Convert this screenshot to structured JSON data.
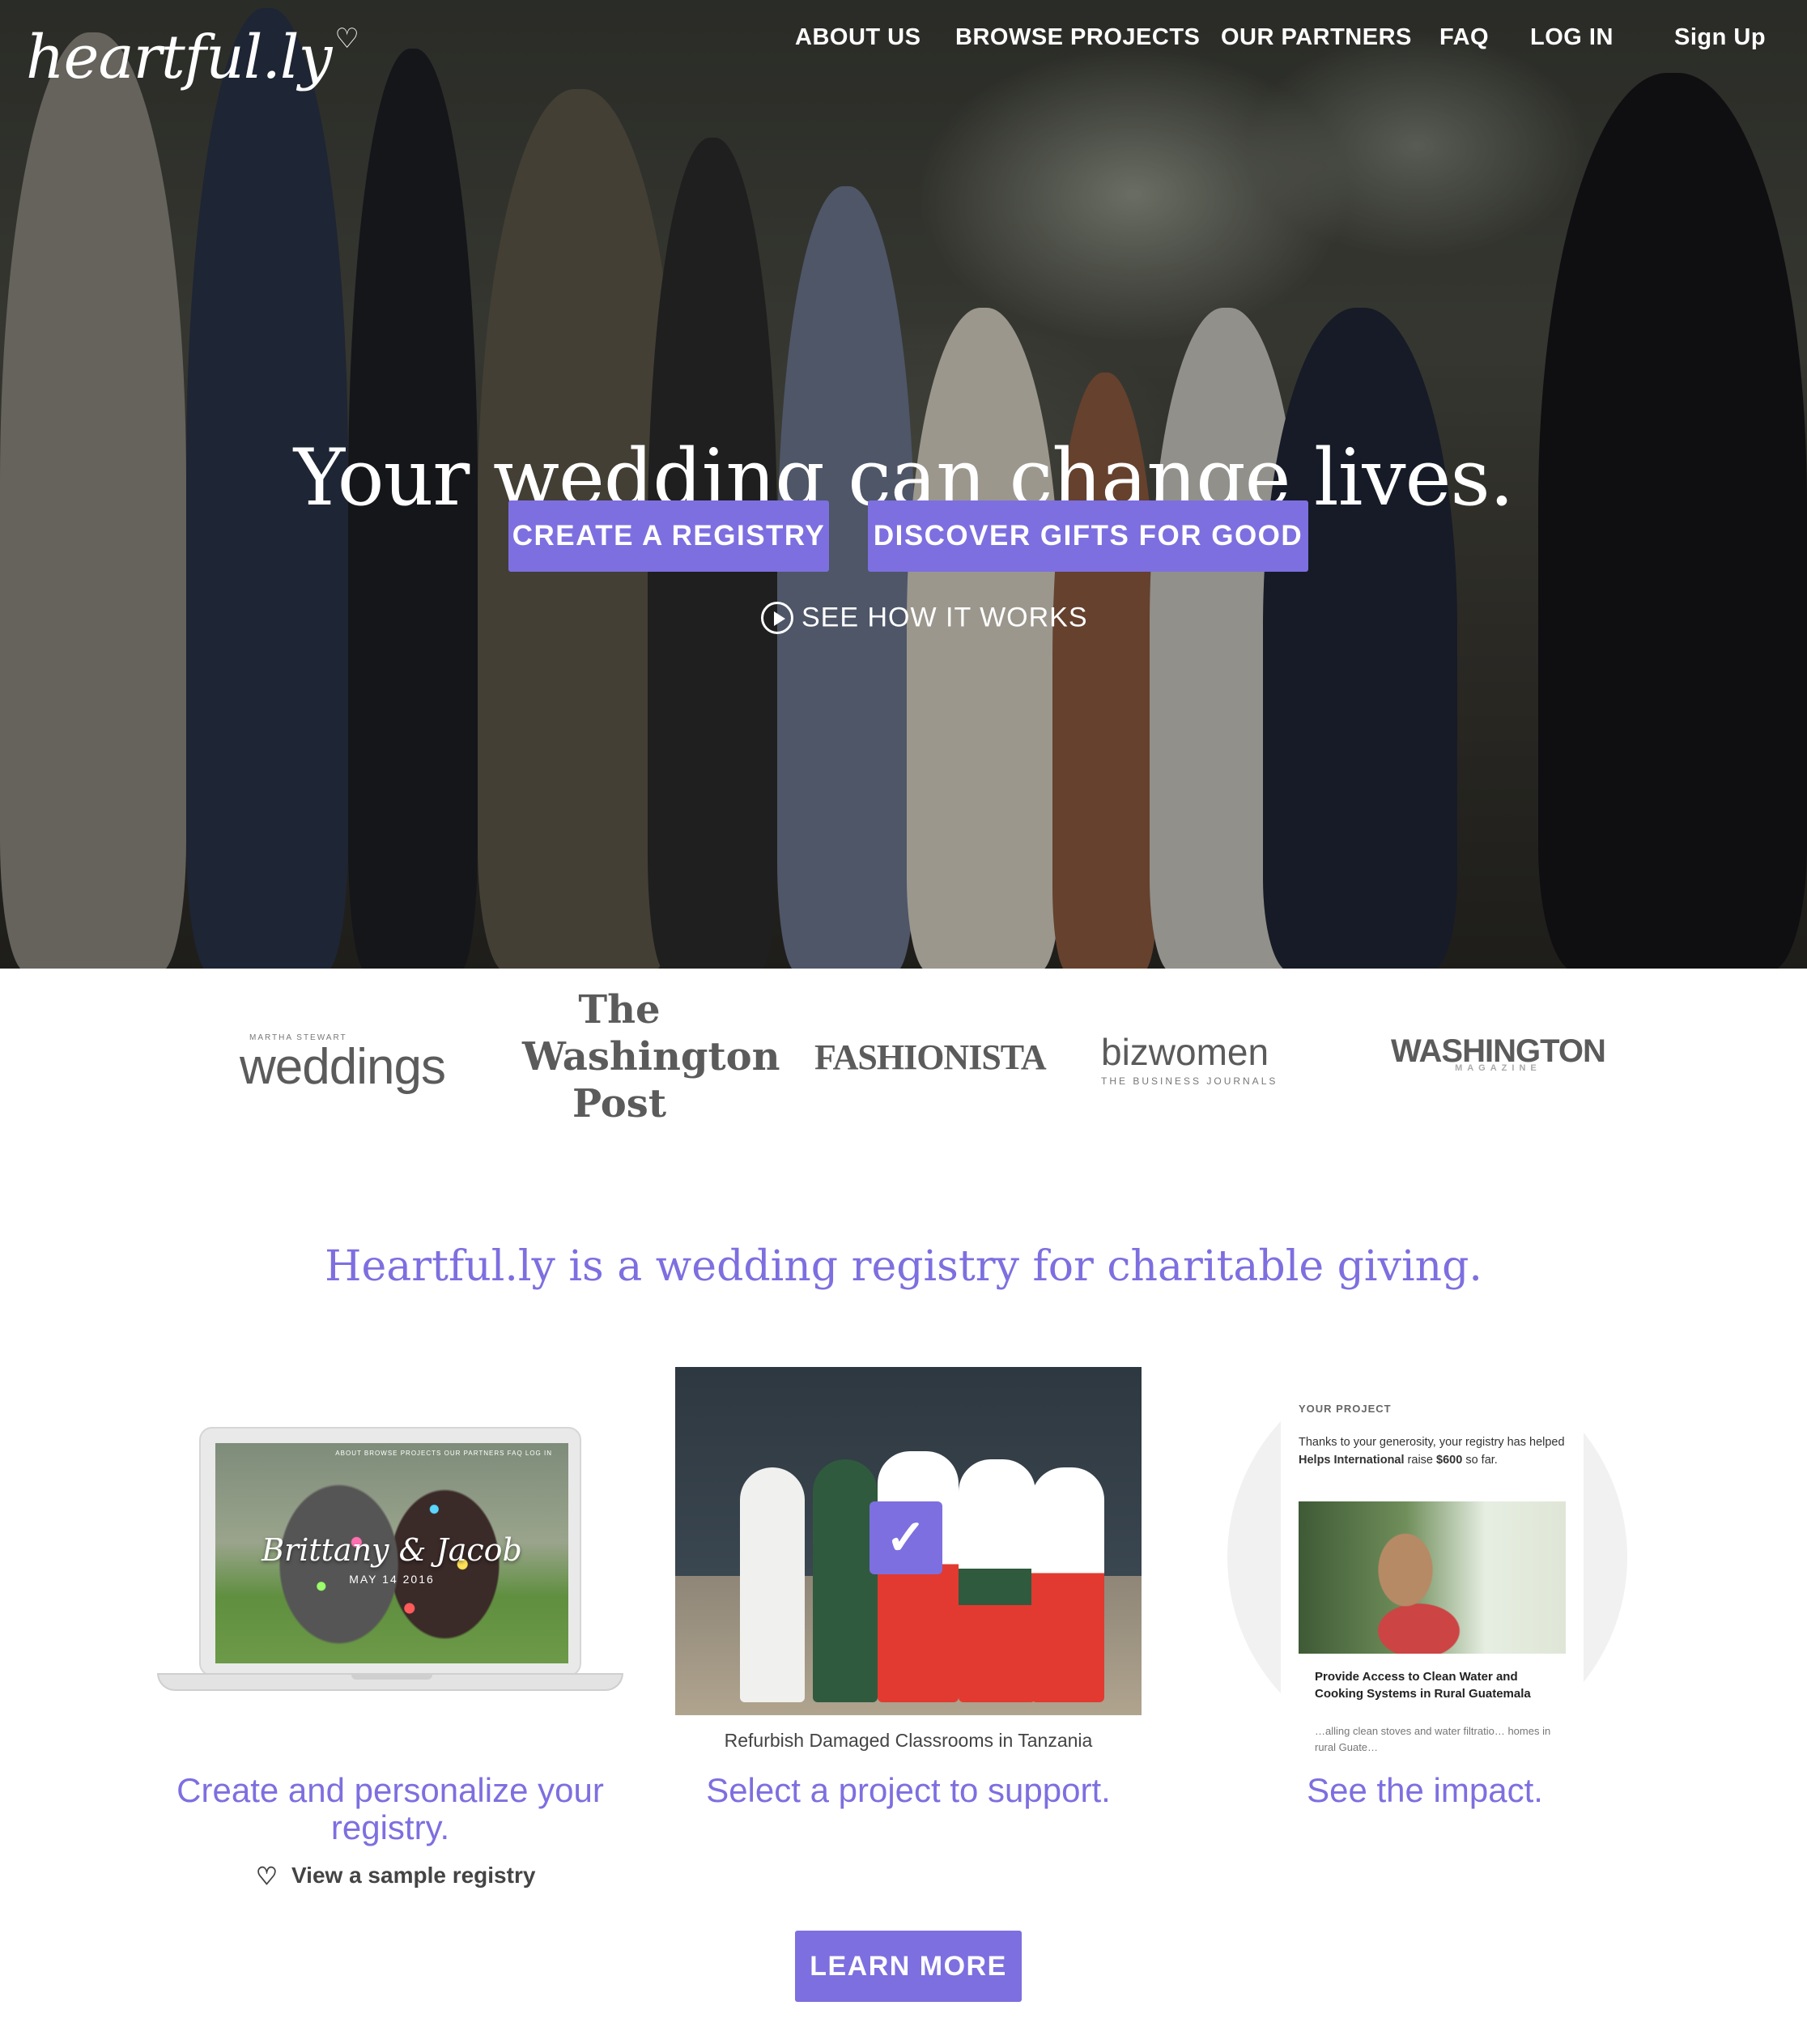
{
  "header": {
    "logo_text": "heartful.ly",
    "logo_heart_icon": "heart-icon",
    "nav": [
      "ABOUT US",
      "BROWSE PROJECTS",
      "OUR PARTNERS",
      "FAQ",
      "LOG IN",
      "Sign Up"
    ]
  },
  "hero": {
    "headline": "Your wedding can change lives.",
    "primary_cta": "CREATE A REGISTRY",
    "secondary_cta": "DISCOVER GIFTS FOR GOOD",
    "video_link": "SEE HOW IT WORKS",
    "video_icon": "play-circle-icon"
  },
  "press": {
    "weddings": "weddings",
    "weddings_super": "MARTHA STEWART",
    "wapo_line1": "The",
    "wapo_line2": "Washington",
    "wapo_line3": "Post",
    "fashionista": "FASHIONISTA",
    "bizwomen": "bizwomen",
    "bizwomen_sub": "THE BUSINESS JOURNALS",
    "washington_life": "WASHINGTON",
    "washington_life_sub": "MAGAZINE"
  },
  "tagline": "Heartful.ly is a wedding registry for charitable giving.",
  "features": {
    "registry": {
      "couple_names": "Brittany & Jacob",
      "date": "MAY 14 2016",
      "mini_nav": "ABOUT  BROWSE PROJECTS  OUR PARTNERS  FAQ  LOG IN",
      "title": "Create and personalize your registry.",
      "link": "View a sample registry"
    },
    "project": {
      "caption": "Refurbish Damaged Classrooms in Tanzania",
      "check_icon": "check-icon",
      "title": "Select a project to support."
    },
    "impact": {
      "heading": "YOUR PROJECT",
      "body_pre": "Thanks to your generosity, your registry has helped ",
      "body_org": "Helps International",
      "body_mid": " raise ",
      "body_amount": "$600",
      "body_post": " so far.",
      "project_title": "Provide Access to Clean Water and Cooking Systems in Rural Guatemala",
      "project_desc": "…alling clean stoves and water filtratio… homes in rural Guate…",
      "title": "See the impact."
    }
  },
  "cta": {
    "learn_more": "LEARN MORE"
  },
  "colors": {
    "accent": "#7d6fe0",
    "text_dark": "#444444"
  }
}
